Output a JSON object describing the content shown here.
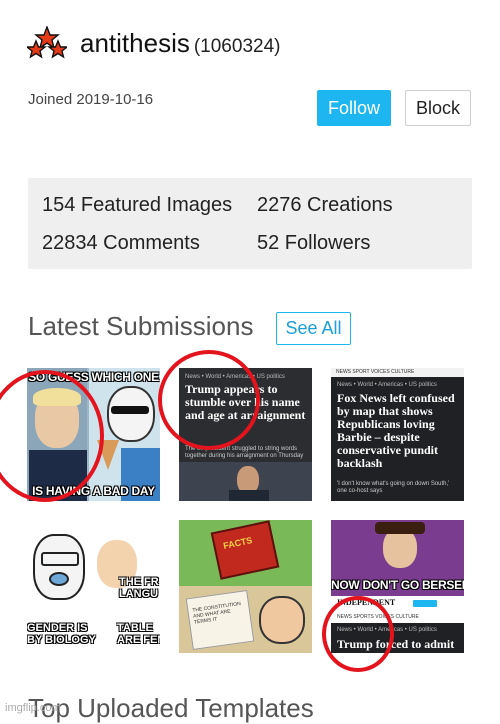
{
  "profile": {
    "username": "antithesis",
    "user_id": "(1060324)",
    "joined": "Joined 2019-10-16",
    "follow_label": "Follow",
    "block_label": "Block"
  },
  "stats": {
    "featured": "154 Featured Images",
    "creations": "2276 Creations",
    "comments": "22834 Comments",
    "followers": "52 Followers"
  },
  "latest": {
    "title": "Latest Submissions",
    "see_all_label": "See All"
  },
  "thumbnails": {
    "t1": {
      "top_text": "SO GUESS WHICH ONE",
      "bottom_text": "IS HAVING A BAD DAY"
    },
    "t2": {
      "breadcrumb": "News • World • Americas • US politics",
      "headline": "Trump appears to stumble over his name and age at arraignment",
      "sub": "The ex-president struggled to string words together during his arraignment on Thursday"
    },
    "t3": {
      "nav": "NEWS   SPORT   VOICES   CULTURE",
      "breadcrumb": "News • World • Americas • US politics",
      "headline": "Fox News left confused by map that shows Republicans loving Barbie – despite conservative pundit backlash",
      "sub": "'I don't know what's going on down South,' one co-host says"
    },
    "t4": {
      "left_text": "GENDER IS\nBY BIOLOGY",
      "right_text": "THE FR\nLANGU",
      "right_bottom": "TABLE\nARE FEMI"
    },
    "t5": {
      "label": "FACTS",
      "paper": "THE CONSTITUTION AND WHAT ARE TERMS IT"
    },
    "t6": {
      "caption": "NOW DON'T GO BERSERK",
      "masthead": "INDEPENDENT",
      "nav": "NEWS   SPORTS   VOICES   CULTURE",
      "breadcrumb": "News • World • Americas • US politics",
      "headline": "Trump forced to admit"
    }
  },
  "bottom": {
    "title": "Top Uploaded Templates"
  },
  "watermark": "imgflip.com",
  "colors": {
    "accent": "#1eb6f0",
    "ring": "#e3141d",
    "stats_bg": "#efefef"
  }
}
